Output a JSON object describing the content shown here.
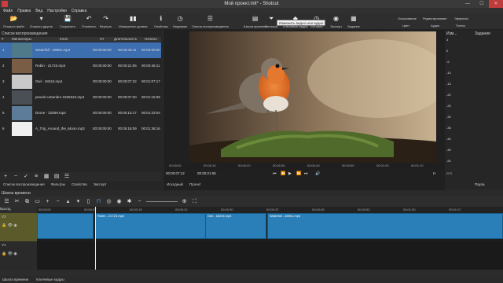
{
  "window": {
    "title": "Мой проект.mlt* - Shotcut",
    "min": "—",
    "max": "☐",
    "close": "✕"
  },
  "menu": [
    "Файл",
    "Правка",
    "Вид",
    "Настройки",
    "Справка"
  ],
  "toolbar": {
    "items": [
      {
        "label": "Открыть файл",
        "icon": "folder-open-icon",
        "glyph": "📂"
      },
      {
        "label": "Открыть другое",
        "icon": "open-other-icon",
        "glyph": "▾"
      },
      {
        "label": "Сохранить",
        "icon": "save-icon",
        "glyph": "💾"
      },
      {
        "label": "Отменить",
        "icon": "undo-icon",
        "glyph": "↶"
      },
      {
        "label": "Вернуть",
        "icon": "redo-icon",
        "glyph": "↷"
      },
      {
        "label": "Измеритель уровня",
        "icon": "peak-meter-icon",
        "glyph": "▮▮"
      },
      {
        "label": "Свойства",
        "icon": "properties-icon",
        "glyph": "ℹ"
      },
      {
        "label": "Недавние",
        "icon": "recent-icon",
        "glyph": "◷"
      },
      {
        "label": "Список воспроизведения",
        "icon": "playlist-icon",
        "glyph": "☰"
      },
      {
        "label": "Шкала времени",
        "icon": "timeline-icon",
        "glyph": "▤"
      },
      {
        "label": "Фильтры",
        "icon": "filter-icon",
        "glyph": "⏷"
      },
      {
        "label": "Ключевые кадры",
        "icon": "keyframes-icon",
        "glyph": "◆"
      },
      {
        "label": "История",
        "icon": "history-icon",
        "glyph": "◷"
      },
      {
        "label": "Экспорт",
        "icon": "export-icon",
        "glyph": "◉"
      },
      {
        "label": "Задание",
        "icon": "jobs-icon",
        "glyph": "▦"
      }
    ],
    "layouts": [
      "Логирование",
      "Редактирование",
      "Эффекты"
    ],
    "layouts2": [
      "Цвет",
      "Аудио",
      "Плеер"
    ],
    "tooltip": "Изменить видео или аудио"
  },
  "playlist": {
    "title": "Список воспроизведения",
    "columns": [
      "#",
      "Миниатюры",
      "Клип",
      "От",
      "Длительность",
      "Начало"
    ],
    "rows": [
      {
        "n": "1",
        "clip": "Waterfall - 48961.mp4",
        "in": "00:00:00:00",
        "dur": "00:00:46:11",
        "start": "00:00:00:00",
        "selected": true,
        "thumb": "#4f7a8a"
      },
      {
        "n": "2",
        "clip": "Robin - 21723.mp4",
        "in": "00:00:00:00",
        "dur": "00:00:21:06",
        "start": "00:00:46:11",
        "selected": false,
        "thumb": "#7a5d45"
      },
      {
        "n": "3",
        "clip": "Owl - 18244.mp4",
        "in": "00:00:00:00",
        "dur": "00:00:07:22",
        "start": "00:01:07:17",
        "selected": false,
        "thumb": "#c9c9c9"
      },
      {
        "n": "4",
        "clip": "pexels-cottonbro-3435324.mp4",
        "in": "00:00:00:00",
        "dur": "00:00:07:20",
        "start": "00:01:15:09",
        "selected": false,
        "thumb": "#4a4f55"
      },
      {
        "n": "5",
        "clip": "Drone - 22059.mp4",
        "in": "00:00:00:00",
        "dur": "00:00:13:17",
        "start": "00:01:23:04",
        "selected": false,
        "thumb": "#5c7c9a"
      },
      {
        "n": "6",
        "clip": "A_Trip_Around_the_Moon.mp3",
        "in": "00:00:00:00",
        "dur": "00:05:18:09",
        "start": "00:01:36:16",
        "selected": false,
        "thumb": "#f0f0f0"
      }
    ],
    "tabs": [
      "Список воспроизведения",
      "Фильтры",
      "Свойства",
      "Экспорт"
    ]
  },
  "player": {
    "ruler": [
      "00:00:00",
      "00:00:10",
      "00:00:20",
      "00:00:30",
      "00:00:40",
      "00:00:50",
      "00:01:00",
      "00:01:10"
    ],
    "timecode": "00:00:07:12",
    "total": "00:00:21:06",
    "rate_label": "Н",
    "tabs": [
      "Исходный",
      "Проект"
    ]
  },
  "right_panel": {
    "title1": "Изм...",
    "title2": "Задания",
    "pause": "Пауза",
    "meters": [
      "3",
      "0",
      "-5",
      "-10",
      "-15",
      "-20",
      "-25",
      "-30",
      "-35",
      "-40",
      "-45",
      "-50"
    ],
    "channels": "Л  П"
  },
  "timeline": {
    "title": "Шкала времени",
    "ruler": [
      "00:00:00",
      "00:00:07",
      "00:00:15",
      "00:00:22",
      "00:00:30",
      "00:00:37",
      "00:00:45",
      "00:00:52",
      "00:01:00",
      "00:01:07"
    ],
    "tracks": [
      {
        "name": "V2"
      },
      {
        "name": "V1"
      }
    ],
    "output": "Выход",
    "clips": [
      {
        "label": "Robin - 21723.mp4",
        "thumb": "#6f5a43"
      },
      {
        "label": "Owl - 18244.mp4",
        "thumb": "#bfbfbf"
      },
      {
        "label": "Waterfall - 48961.mp4",
        "thumb": "#41606b"
      }
    ]
  },
  "bottom_tabs": [
    "Шкала времени",
    "Ключевые кадры"
  ],
  "colors": {
    "accent": "#3d6eaf",
    "clip": "#2a7fb8"
  }
}
